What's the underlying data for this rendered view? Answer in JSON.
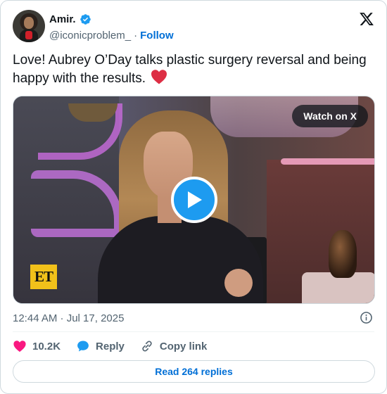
{
  "author": {
    "display_name": "Amir.",
    "handle": "@iconicproblem_",
    "separator": "·",
    "follow_label": "Follow"
  },
  "tweet": {
    "text": "Love! Aubrey O’Day talks plastic surgery reversal and being happy with the results."
  },
  "media": {
    "watch_label": "Watch on X",
    "et_logo_text": "ET"
  },
  "meta": {
    "timestamp": "12:44 AM · Jul 17, 2025"
  },
  "actions": {
    "like_count": "10.2K",
    "reply_label": "Reply",
    "copy_link_label": "Copy link"
  },
  "replies_button": {
    "label": "Read 264 replies"
  },
  "colors": {
    "accent": "#1d9bf0",
    "link": "#006fd6",
    "like": "#f91880",
    "muted": "#536471"
  },
  "icons": {
    "verified": "verified-badge-icon",
    "x_logo": "x-logo-icon",
    "heart_emoji": "red-heart-emoji",
    "play": "play-icon",
    "info": "info-icon",
    "like": "heart-icon",
    "reply": "reply-bubble-icon",
    "copy_link": "link-icon"
  }
}
